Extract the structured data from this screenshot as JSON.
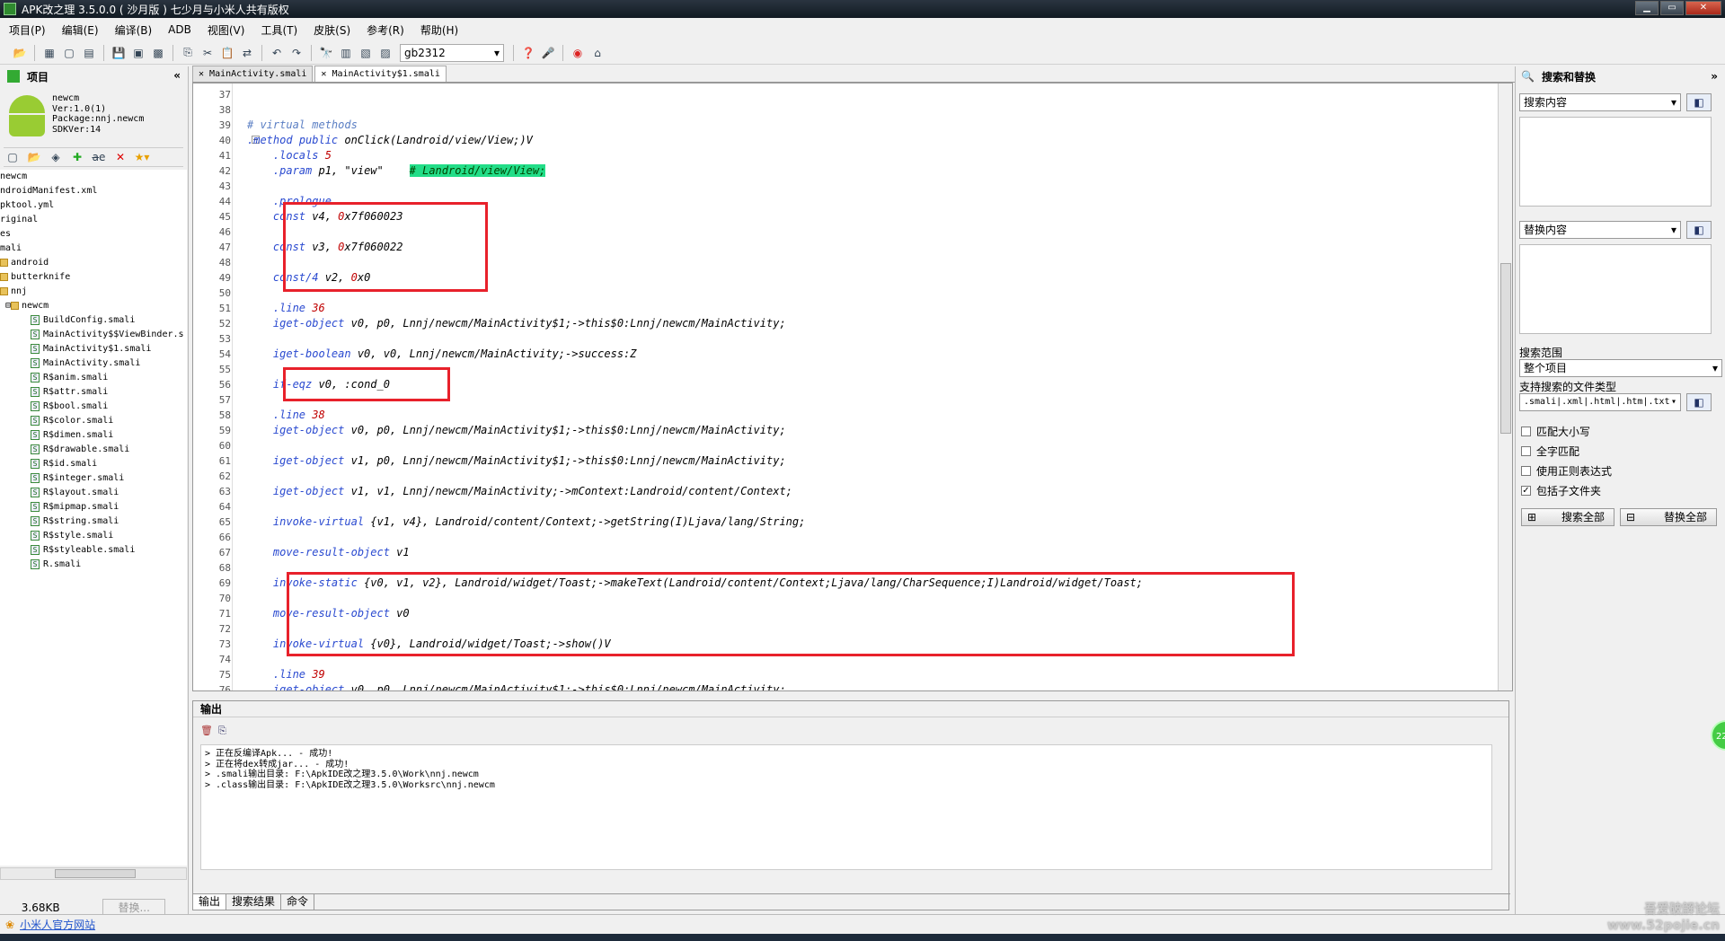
{
  "window": {
    "title": "APK改之理 3.5.0.0 ( 沙月版 ) 七少月与小米人共有版权"
  },
  "menu": [
    "项目(P)",
    "编辑(E)",
    "编译(B)",
    "ADB",
    "视图(V)",
    "工具(T)",
    "皮肤(S)",
    "参考(R)",
    "帮助(H)"
  ],
  "toolbar": {
    "encoding": "gb2312"
  },
  "project": {
    "title": "项目",
    "apk": {
      "name": "newcm",
      "ver": "Ver:1.0(1)",
      "package": "Package:nnj.newcm",
      "sdk": "SDKVer:14"
    },
    "tree": [
      "newcm",
      "ndroidManifest.xml",
      "pktool.yml",
      "riginal",
      "es",
      "mali",
      "android",
      "butterknife",
      "nnj",
      "newcm",
      "BuildConfig.smali",
      "MainActivity$$ViewBinder.s",
      "MainActivity$1.smali",
      "MainActivity.smali",
      "R$anim.smali",
      "R$attr.smali",
      "R$bool.smali",
      "R$color.smali",
      "R$dimen.smali",
      "R$drawable.smali",
      "R$id.smali",
      "R$integer.smali",
      "R$layout.smali",
      "R$mipmap.smali",
      "R$string.smali",
      "R$style.smali",
      "R$styleable.smali",
      "R.smali"
    ],
    "size": "3.68KB",
    "replace_button": "替换..."
  },
  "tabs": [
    "MainActivity.smali",
    "MainActivity$1.smali"
  ],
  "editor": {
    "lines": [
      {
        "n": "37",
        "t": ""
      },
      {
        "n": "38",
        "t": ""
      },
      {
        "n": "39",
        "t": "# virtual methods"
      },
      {
        "n": "40",
        "t": ".method public onClick(Landroid/view/View;)V"
      },
      {
        "n": "41",
        "t": "    .locals 5"
      },
      {
        "n": "42",
        "t": "    .param p1, \"view\"    "
      },
      {
        "n": "43",
        "t": ""
      },
      {
        "n": "44",
        "t": "    .prologue"
      },
      {
        "n": "45",
        "t": "    const v4, 0x7f060023"
      },
      {
        "n": "46",
        "t": ""
      },
      {
        "n": "47",
        "t": "    const v3, 0x7f060022"
      },
      {
        "n": "48",
        "t": ""
      },
      {
        "n": "49",
        "t": "    const/4 v2, 0x0"
      },
      {
        "n": "50",
        "t": ""
      },
      {
        "n": "51",
        "t": "    .line 36"
      },
      {
        "n": "52",
        "t": "    iget-object v0, p0, Lnnj/newcm/MainActivity$1;->this$0:Lnnj/newcm/MainActivity;"
      },
      {
        "n": "53",
        "t": ""
      },
      {
        "n": "54",
        "t": "    iget-boolean v0, v0, Lnnj/newcm/MainActivity;->success:Z"
      },
      {
        "n": "55",
        "t": ""
      },
      {
        "n": "56",
        "t": "    if-eqz v0, :cond_0"
      },
      {
        "n": "57",
        "t": ""
      },
      {
        "n": "58",
        "t": "    .line 38"
      },
      {
        "n": "59",
        "t": "    iget-object v0, p0, Lnnj/newcm/MainActivity$1;->this$0:Lnnj/newcm/MainActivity;"
      },
      {
        "n": "60",
        "t": ""
      },
      {
        "n": "61",
        "t": "    iget-object v1, p0, Lnnj/newcm/MainActivity$1;->this$0:Lnnj/newcm/MainActivity;"
      },
      {
        "n": "62",
        "t": ""
      },
      {
        "n": "63",
        "t": "    iget-object v1, v1, Lnnj/newcm/MainActivity;->mContext:Landroid/content/Context;"
      },
      {
        "n": "64",
        "t": ""
      },
      {
        "n": "65",
        "t": "    invoke-virtual {v1, v4}, Landroid/content/Context;->getString(I)Ljava/lang/String;"
      },
      {
        "n": "66",
        "t": ""
      },
      {
        "n": "67",
        "t": "    move-result-object v1"
      },
      {
        "n": "68",
        "t": ""
      },
      {
        "n": "69",
        "t": "    invoke-static {v0, v1, v2}, Landroid/widget/Toast;->makeText(Landroid/content/Context;Ljava/lang/CharSequence;I)Landroid/widget/Toast;"
      },
      {
        "n": "70",
        "t": ""
      },
      {
        "n": "71",
        "t": "    move-result-object v0"
      },
      {
        "n": "72",
        "t": ""
      },
      {
        "n": "73",
        "t": "    invoke-virtual {v0}, Landroid/widget/Toast;->show()V"
      },
      {
        "n": "74",
        "t": ""
      },
      {
        "n": "75",
        "t": "    .line 39"
      },
      {
        "n": "76",
        "t": "    iget-object v0, p0, Lnnj/newcm/MainActivity$1;->this$0:Lnnj/newcm/MainActivity;"
      }
    ],
    "comment_highlight": "# Landroid/view/View;"
  },
  "output": {
    "title": "输出",
    "lines": [
      "> 正在反编译Apk... - 成功!",
      "> 正在将dex转成jar... - 成功!",
      "> .smali输出目录: F:\\ApkIDE改之理3.5.0\\Work\\nnj.newcm",
      "> .class输出目录: F:\\ApkIDE改之理3.5.0\\Worksrc\\nnj.newcm"
    ],
    "tabs": [
      "输出",
      "搜索结果",
      "命令"
    ]
  },
  "search": {
    "title": "搜索和替换",
    "search_label": "搜索内容",
    "replace_label": "替换内容",
    "scope_label": "搜索范围",
    "scope_value": "整个项目",
    "filetypes_label": "支持搜索的文件类型",
    "filetypes_value": ".smali|.xml|.html|.htm|.txt",
    "options": [
      {
        "label": "匹配大小写",
        "checked": false
      },
      {
        "label": "全字匹配",
        "checked": false
      },
      {
        "label": "使用正则表达式",
        "checked": false
      },
      {
        "label": "包括子文件夹",
        "checked": true
      }
    ],
    "search_all": "搜索全部",
    "replace_all": "替换全部"
  },
  "status": {
    "link": "小米人官方网站"
  },
  "watermark": "吾爱破解论坛\nwww.52pojie.cn",
  "bubble": "22"
}
